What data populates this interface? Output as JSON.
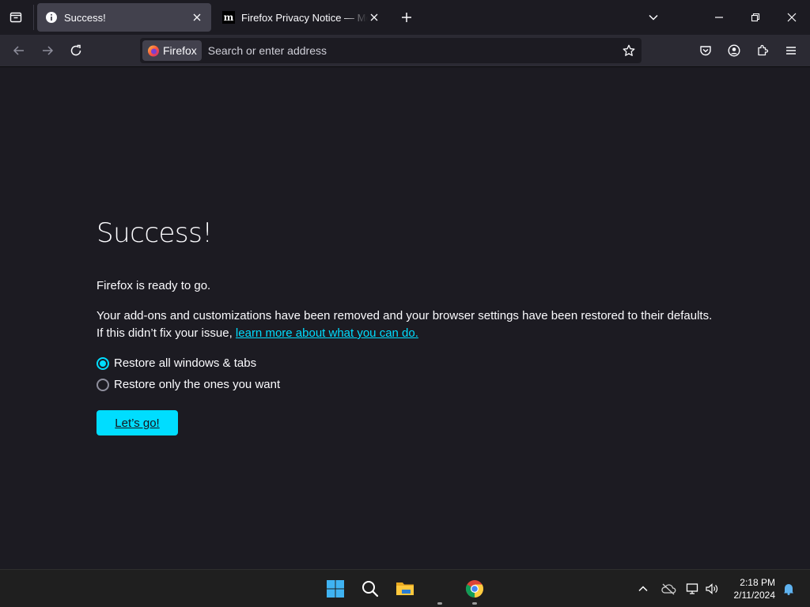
{
  "tabs": [
    {
      "title": "Success!",
      "active": true
    },
    {
      "title": "Firefox Privacy Notice — Mozilla",
      "active": false
    }
  ],
  "urlbar": {
    "identity_label": "Firefox",
    "placeholder": "Search or enter address"
  },
  "page": {
    "heading": "Success!",
    "ready": "Firefox is ready to go.",
    "body_line1": "Your add-ons and customizations have been removed and your browser settings have been restored to their defaults.",
    "body_line2_prefix": "If this didn’t fix your issue,",
    "learn_more_link": "learn more about what you can do.",
    "options": [
      {
        "label": "Restore all windows & tabs",
        "checked": true
      },
      {
        "label": "Restore only the ones you want",
        "checked": false
      }
    ],
    "go_button": "Let’s go!"
  },
  "taskbar": {
    "time": "2:18 PM",
    "date": "2/11/2024"
  },
  "colors": {
    "accent": "#00ddff",
    "background": "#1c1b22",
    "toolbar": "#2b2a33"
  }
}
